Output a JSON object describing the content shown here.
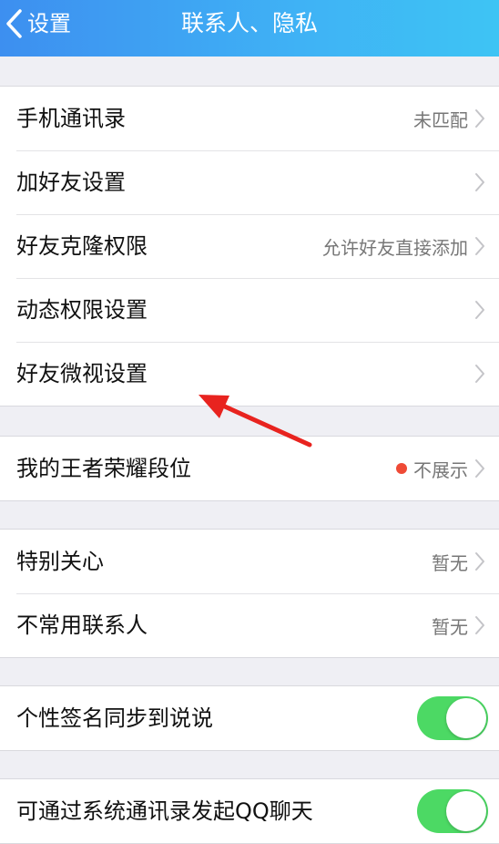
{
  "nav": {
    "back_label": "设置",
    "title": "联系人、隐私"
  },
  "colors": {
    "nav_start": "#3d8ff0",
    "nav_end": "#3ec4f4",
    "toggle_on": "#4cd964",
    "red_dot": "#ef4a36",
    "annotation_arrow": "#e8231f"
  },
  "group1": {
    "rows": [
      {
        "label": "手机通讯录",
        "value": "未匹配"
      },
      {
        "label": "加好友设置",
        "value": ""
      },
      {
        "label": "好友克隆权限",
        "value": "允许好友直接添加"
      },
      {
        "label": "动态权限设置",
        "value": ""
      },
      {
        "label": "好友微视设置",
        "value": ""
      }
    ]
  },
  "group2": {
    "rows": [
      {
        "label": "我的王者荣耀段位",
        "value": "不展示",
        "dot": true
      }
    ]
  },
  "group3": {
    "rows": [
      {
        "label": "特别关心",
        "value": "暂无"
      },
      {
        "label": "不常用联系人",
        "value": "暂无"
      }
    ]
  },
  "group4": {
    "rows": [
      {
        "label": "个性签名同步到说说",
        "toggle": true
      }
    ]
  },
  "group5": {
    "rows": [
      {
        "label": "可通过系统通讯录发起QQ聊天",
        "toggle": true
      }
    ]
  },
  "icons": {
    "back": "chevron-left-icon",
    "disclosure": "chevron-right-icon",
    "annotation": "red-arrow-icon"
  }
}
